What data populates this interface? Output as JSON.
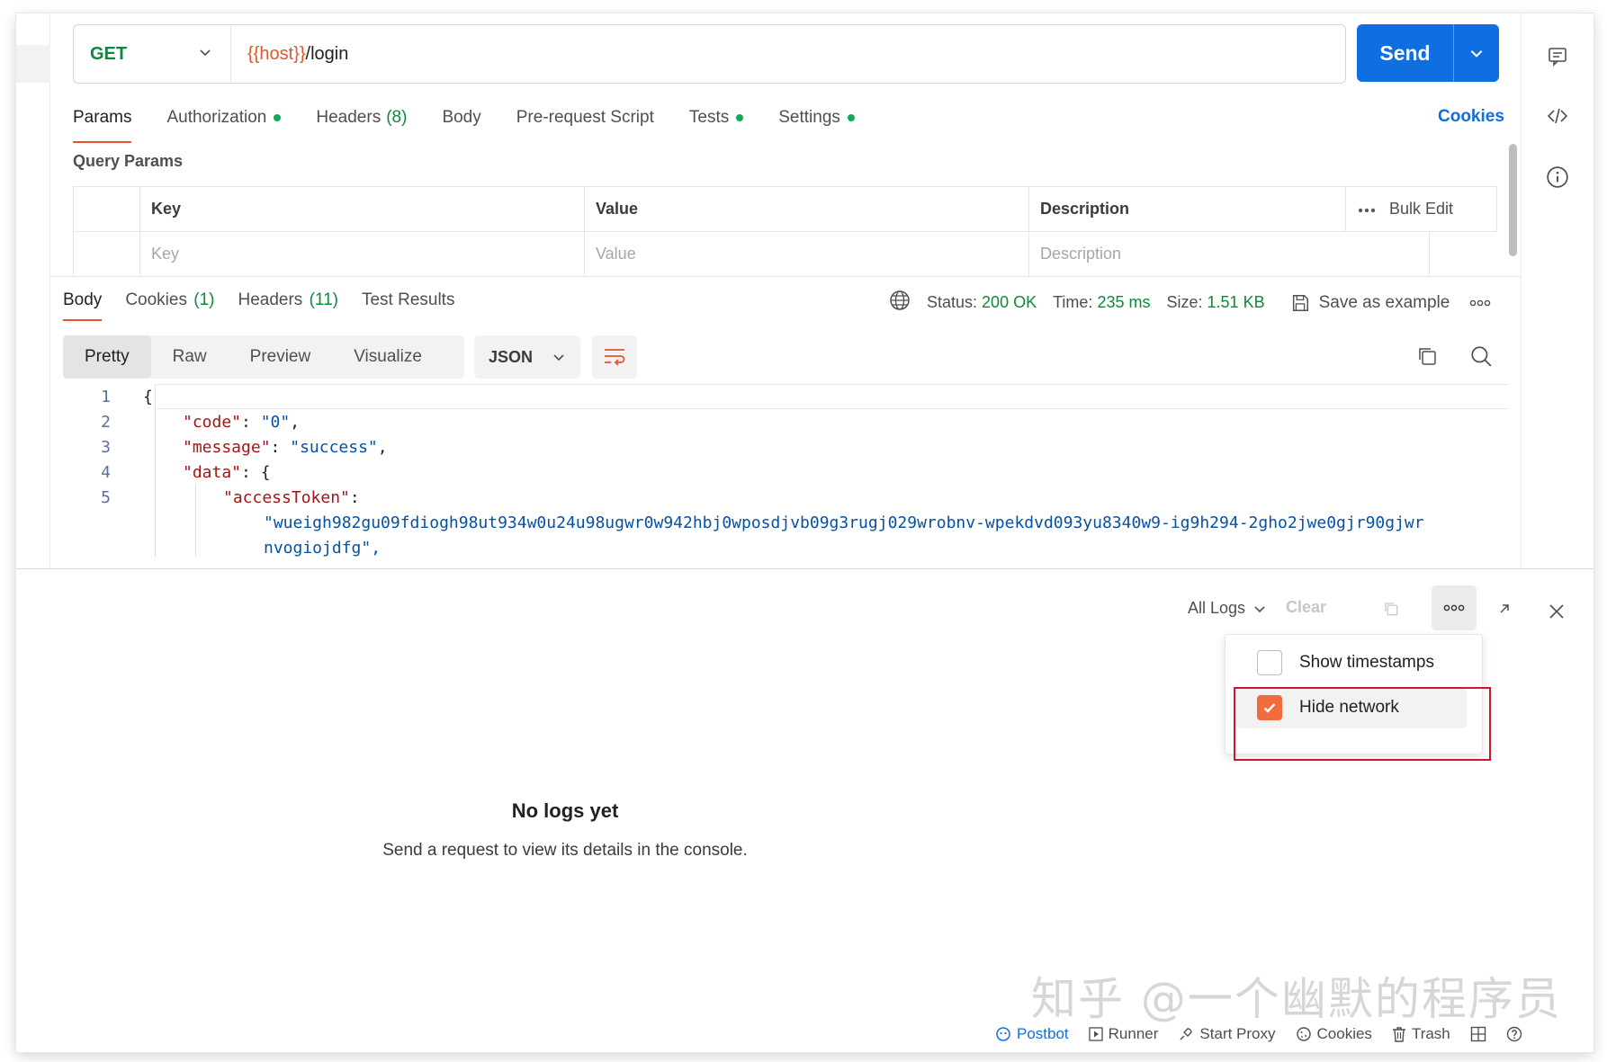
{
  "request": {
    "method": "GET",
    "url_var": "{{host}}",
    "url_path": "/login",
    "send_label": "Send",
    "tabs": [
      {
        "label": "Params",
        "active": true
      },
      {
        "label": "Authorization",
        "dot": true
      },
      {
        "label": "Headers",
        "count": "(8)"
      },
      {
        "label": "Body"
      },
      {
        "label": "Pre-request Script"
      },
      {
        "label": "Tests",
        "dot": true
      },
      {
        "label": "Settings",
        "dot": true
      }
    ],
    "cookies_link": "Cookies",
    "query_params": {
      "title": "Query Params",
      "headers": {
        "key": "Key",
        "value": "Value",
        "description": "Description",
        "bulk_edit": "Bulk Edit"
      },
      "placeholders": {
        "key": "Key",
        "value": "Value",
        "description": "Description"
      }
    }
  },
  "response": {
    "tabs": [
      {
        "label": "Body",
        "active": true
      },
      {
        "label": "Cookies",
        "count": "(1)"
      },
      {
        "label": "Headers",
        "count": "(11)"
      },
      {
        "label": "Test Results"
      }
    ],
    "status_label": "Status:",
    "status_value": "200 OK",
    "time_label": "Time:",
    "time_value": "235 ms",
    "size_label": "Size:",
    "size_value": "1.51 KB",
    "save_example": "Save as example",
    "views": [
      "Pretty",
      "Raw",
      "Preview",
      "Visualize"
    ],
    "active_view": "Pretty",
    "format": "JSON",
    "code": {
      "line_numbers": [
        "1",
        "2",
        "3",
        "4",
        "5"
      ],
      "l1": "{",
      "l2_key": "\"code\"",
      "l2_sep": ": ",
      "l2_val": "\"0\"",
      "l2_end": ",",
      "l3_key": "\"message\"",
      "l3_sep": ": ",
      "l3_val": "\"success\"",
      "l3_end": ",",
      "l4_key": "\"data\"",
      "l4_sep": ": {",
      "l5_key": "\"accessToken\"",
      "l5_sep": ":",
      "l5_val1": "\"wueigh982gu09fdiogh98ut934w0u24u98ugwr0w942hbj0wposdjvb09g3rugj029wrobnv-wpekdvd093yu8340w9-ig9h294-2gho2jwe0gjr90gjwr",
      "l5_val2": "nvogiojdfg\","
    }
  },
  "console": {
    "filter": "All Logs",
    "clear": "Clear",
    "menu": {
      "show_timestamps": "Show timestamps",
      "show_timestamps_checked": false,
      "hide_network": "Hide network",
      "hide_network_checked": true
    },
    "empty_title": "No logs yet",
    "empty_subtitle": "Send a request to view its details in the console."
  },
  "watermark": "知乎 @一个幽默的程序员",
  "status_bar": {
    "postbot": "Postbot",
    "runner": "Runner",
    "start_proxy": "Start Proxy",
    "cookies": "Cookies",
    "trash": "Trash"
  },
  "colors": {
    "accent_blue": "#0f6fe0",
    "orange": "#e5552b",
    "green": "#0b8a3c",
    "checkbox_orange": "#f26b3a",
    "highlight_red": "#d0162a"
  }
}
